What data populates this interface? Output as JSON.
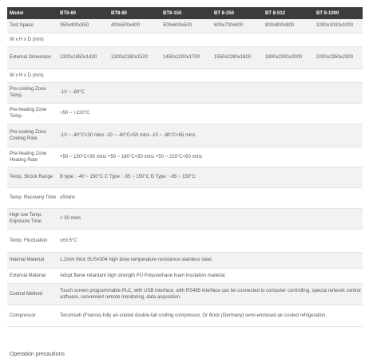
{
  "header": {
    "model": "Model",
    "models": [
      "BT8-60",
      "BT8-80",
      "BT8-150",
      "BT 8-250",
      "BT 8-512",
      "BT 8-1000"
    ]
  },
  "rows": [
    {
      "label": "Test Space",
      "values": [
        "350x400x350",
        "400x500x400",
        "500x600x500",
        "600x700x600",
        "800x800x800",
        "1000x1000x1000"
      ]
    },
    {
      "label": "W x H x D (mm)",
      "text": ""
    },
    {
      "label": "External Dimension",
      "values": [
        "1320x1850x1420",
        "1320x2180x1520",
        "1450x2200x1700",
        "1550x2280x1800",
        "1800x2300x2000",
        "2000x2350x2300"
      ]
    },
    {
      "label": "W x H x D (mm)",
      "text": ""
    },
    {
      "label": "Pre-cooling Zone Temp.",
      "text": "-10 ~ -80°C"
    },
    {
      "label": "Pre-heating Zone Temp.",
      "text": "+50 ~ +220°C"
    },
    {
      "label": "Pre-cooling Zone Cooling Rate",
      "text": "-10 ~ -40°C<30 mins    -10 ~ -60°C<50 mins    -10 ~ -80°C<65 mins"
    },
    {
      "label": "Pre-heating Zone Heating Rate",
      "text": "+50 ~ 150°C<30 mins    +50 ~ 180°C<50 mins    +50 ~ 220°C<60 mins"
    },
    {
      "label": "Temp. Shock Range",
      "text": "B type : -40 ~ 150°C    C Type : -55 ~ 150°C    D Type : -65 ~ 150°C"
    },
    {
      "label": "Temp. Recovery Time",
      "text": "≤5mins"
    },
    {
      "label": "High low Temp. Exposure Time",
      "text": "< 30 mins"
    },
    {
      "label": "Temp. Fluctuation",
      "text": "≤±0.5°C"
    },
    {
      "label": "Internal Material",
      "text": "1.2mm thick SUS#304 high &low temperature resistance stainless steel."
    },
    {
      "label": "External Material",
      "text": "Adopt flame retardant high strength PU Polyurethane foam insulation material."
    },
    {
      "label": "Control Method",
      "text": "Touch screen programmable PLC, with USB interface, with RS485 interface can be connected to computer controlling, special network control software, convenient remote monitoring, data acquisition."
    },
    {
      "label": "Compressor",
      "text": "Tecumseh (France)-fully air-cooled double-fail cooling compressor, Or Bock (Germany) semi-enclosed air-cooled refrigeration."
    }
  ],
  "footer": {
    "heading": "Operation precautions"
  }
}
